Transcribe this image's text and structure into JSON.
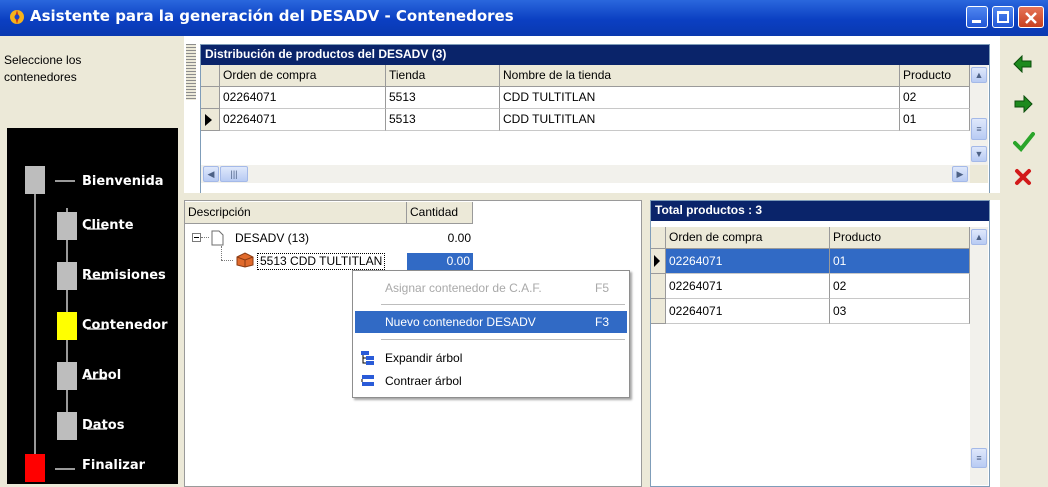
{
  "window": {
    "title": "Asistente para la generación del DESADV - Contenedores",
    "colors": {
      "titlebar": "#0a3fc0",
      "grid_header": "#0a246a",
      "selection": "#316ac5"
    }
  },
  "left": {
    "instruction": "Seleccione los contenedores",
    "steps": [
      {
        "label": "Bienvenida",
        "state": "done"
      },
      {
        "label": "Cliente",
        "state": "done"
      },
      {
        "label": "Remisiones",
        "state": "done"
      },
      {
        "label": "Contenedor",
        "state": "current"
      },
      {
        "label": "Arbol",
        "state": "pending"
      },
      {
        "label": "Datos",
        "state": "pending"
      },
      {
        "label": "Finalizar",
        "state": "final"
      }
    ]
  },
  "distribution": {
    "title": "Distribución de productos del DESADV (3)",
    "columns": [
      "Orden de compra",
      "Tienda",
      "Nombre de la tienda",
      "Producto"
    ],
    "rows": [
      {
        "orden": "02264071",
        "tienda": "5513",
        "nombre": "CDD TULTITLAN",
        "producto": "02"
      },
      {
        "orden": "02264071",
        "tienda": "5513",
        "nombre": "CDD TULTITLAN",
        "producto": "01"
      }
    ]
  },
  "tree": {
    "columns": [
      "Descripción",
      "Cantidad"
    ],
    "root": {
      "label": "DESADV (13)",
      "qty": "0.00"
    },
    "child": {
      "label": "5513  CDD TULTITLAN",
      "qty": "0.00"
    }
  },
  "totals": {
    "title": "Total productos : 3",
    "columns": [
      "Orden de compra",
      "Producto"
    ],
    "rows": [
      {
        "orden": "02264071",
        "producto": "01"
      },
      {
        "orden": "02264071",
        "producto": "02"
      },
      {
        "orden": "02264071",
        "producto": "03"
      }
    ]
  },
  "context_menu": {
    "assign_label": "Asignar contenedor de C.A.F.",
    "assign_key": "F5",
    "new_label": "Nuevo contenedor DESADV",
    "new_key": "F3",
    "expand_label": "Expandir árbol",
    "collapse_label": "Contraer árbol"
  },
  "toolbar_icons": [
    "back-arrow-icon",
    "forward-arrow-icon",
    "check-icon",
    "cancel-icon"
  ]
}
